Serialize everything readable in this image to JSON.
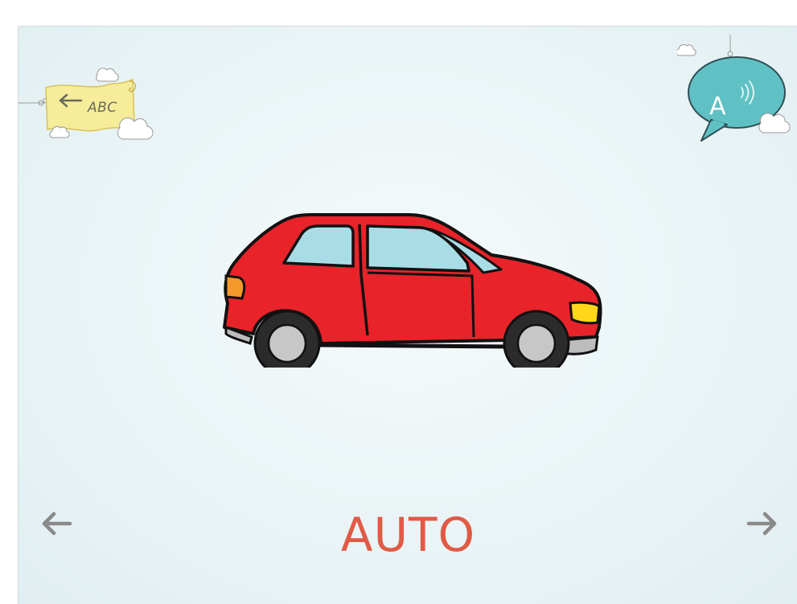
{
  "nav": {
    "back_label": "ABC",
    "prev_icon": "arrow-left-icon",
    "next_icon": "arrow-right-icon"
  },
  "speech": {
    "letter": "A",
    "icon": "speaker-wave-icon"
  },
  "card": {
    "picture_icon": "car-icon",
    "word": "AUTO"
  },
  "colors": {
    "word": "#e05a45",
    "flag": "#f7ec9a",
    "bubble": "#5fc1c4",
    "car_body": "#e8232a",
    "arrow": "#8a8a8a"
  }
}
